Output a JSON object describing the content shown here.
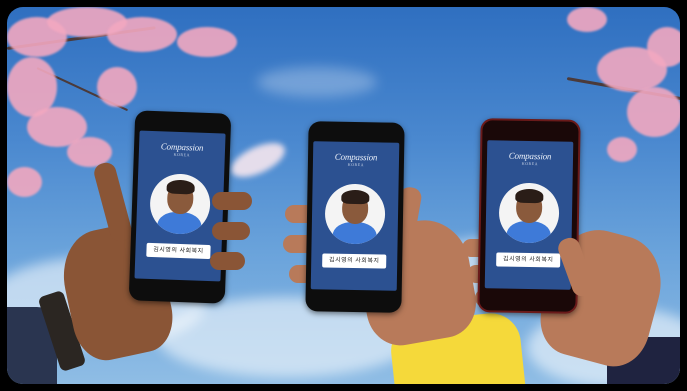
{
  "scene": {
    "phones": [
      {
        "logo": "Compassion",
        "tag": "김시영의 사회복지"
      },
      {
        "logo": "Compassion",
        "tag": "김시영의 사회복지"
      },
      {
        "logo": "Compassion",
        "tag": "김시영의 사회복지"
      }
    ]
  },
  "colors": {
    "sky": "#4a88cf",
    "screen": "#2c5191",
    "blossom": "#f2a8c0",
    "sleeve_yellow": "#f5d93a",
    "sleeve_navy": "#1f2340"
  }
}
